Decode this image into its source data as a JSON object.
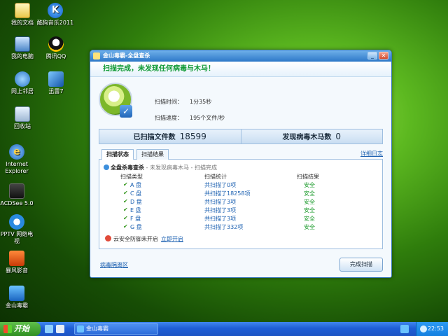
{
  "desktop": {
    "icons": [
      {
        "label": "我的文档",
        "icon": "documents-folder-icon"
      },
      {
        "label": "酷狗音乐2011",
        "icon": "kugou-music-icon"
      },
      {
        "label": "我的电脑",
        "icon": "my-computer-icon"
      },
      {
        "label": "腾讯QQ",
        "icon": "qq-penguin-icon"
      },
      {
        "label": "网上邻居",
        "icon": "network-places-icon"
      },
      {
        "label": "迅雷7",
        "icon": "thunder-icon"
      },
      {
        "label": "回收站",
        "icon": "recycle-bin-icon"
      },
      {
        "label": "Internet Explorer",
        "icon": "internet-explorer-icon"
      },
      {
        "label": "ACDSee 5.0",
        "icon": "acdsee-icon"
      },
      {
        "label": "PPTV 网络电视",
        "icon": "pptv-icon"
      },
      {
        "label": "暴风影音",
        "icon": "baofeng-player-icon"
      },
      {
        "label": "金山毒霸",
        "icon": "kingsoft-antivirus-icon"
      }
    ]
  },
  "window": {
    "title": "金山毒霸-全盘查杀",
    "banner": "扫描完成，未发现任何病毒与木马！",
    "scan_time_label": "扫描时间：",
    "scan_time_value": "1分35秒",
    "scan_speed_label": "扫描速度：",
    "scan_speed_value": "195个文件/秒",
    "files_scanned_label": "已扫描文件数",
    "files_scanned_value": "18599",
    "threats_found_label": "发现病毒木马数",
    "threats_found_value": "0",
    "tabs": [
      {
        "label": "扫描状态"
      },
      {
        "label": "扫描结果"
      }
    ],
    "detail_log": "详细日志",
    "section_title": "全盘杀毒查杀",
    "section_sub": " - 未发现病毒木马 - 扫描完成",
    "headers": {
      "type": "扫描类型",
      "stats": "扫描统计",
      "result": "扫描结果"
    },
    "drives": [
      {
        "name": "A 盘",
        "count": "共扫描了0项",
        "result": "安全"
      },
      {
        "name": "C 盘",
        "count": "共扫描了18258项",
        "result": "安全"
      },
      {
        "name": "D 盘",
        "count": "共扫描了3项",
        "result": "安全"
      },
      {
        "name": "E 盘",
        "count": "共扫描了3项",
        "result": "安全"
      },
      {
        "name": "F 盘",
        "count": "共扫描了3项",
        "result": "安全"
      },
      {
        "name": "G 盘",
        "count": "共扫描了332项",
        "result": "安全"
      }
    ],
    "cloud_text": "云安全防御未开启",
    "cloud_link": "立即开启",
    "quarantine_link": "病毒隔离区",
    "finish_button": "完成扫描"
  },
  "taskbar": {
    "start": "开始",
    "task_item": "金山毒霸",
    "clock": "22:53"
  },
  "colors": {
    "accent": "#2d78c8",
    "success": "#0f9a34",
    "link": "#1a5fb0"
  }
}
